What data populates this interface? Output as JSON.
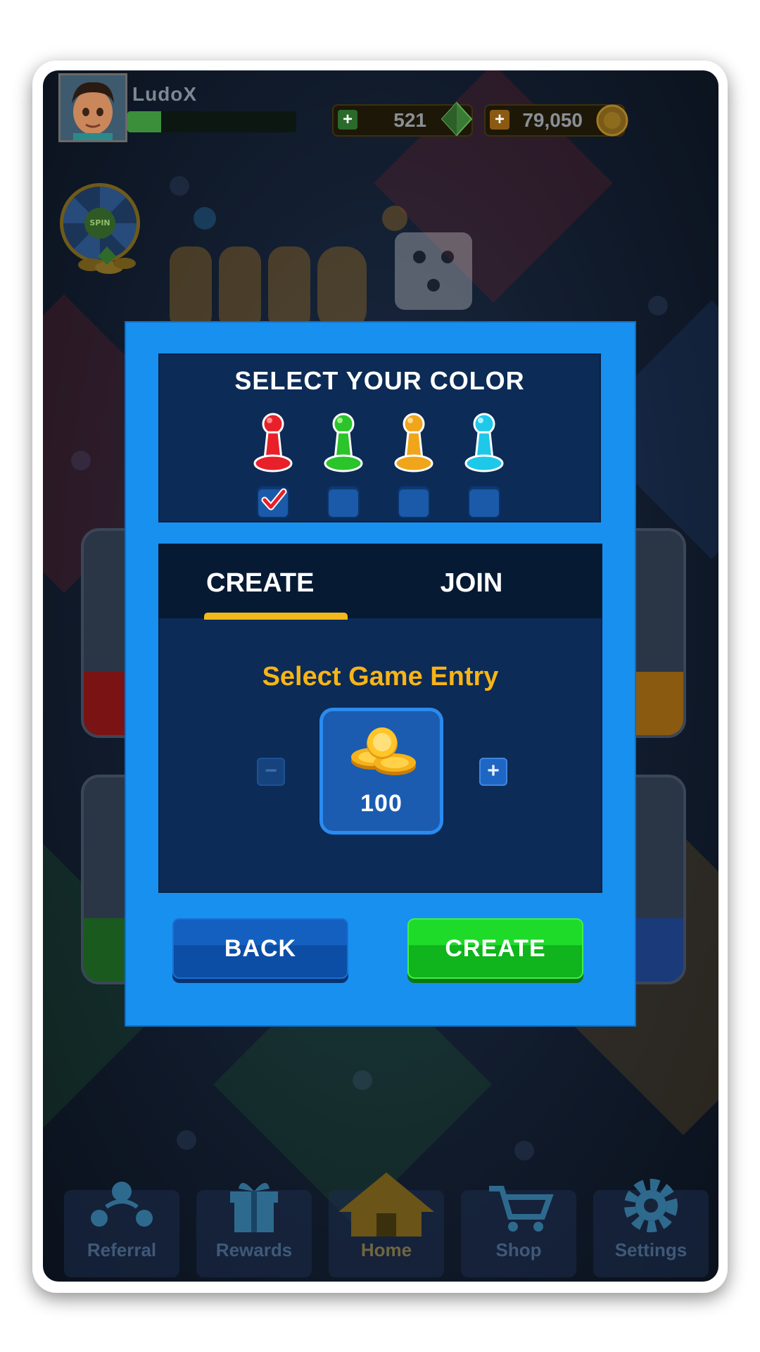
{
  "header": {
    "username": "LudoX",
    "xp_progress": 0.2,
    "gems": "521",
    "coins": "79,050"
  },
  "spin_wheel": {
    "label": "SPIN"
  },
  "color_select": {
    "title": "SELECT YOUR COLOR",
    "colors": [
      {
        "name": "red",
        "hex": "#e8202a",
        "selected": true
      },
      {
        "name": "green",
        "hex": "#2bc42a",
        "selected": false
      },
      {
        "name": "yellow",
        "hex": "#f0a51a",
        "selected": false
      },
      {
        "name": "cyan",
        "hex": "#1ec8e8",
        "selected": false
      }
    ]
  },
  "tabs": [
    {
      "label": "CREATE",
      "active": true
    },
    {
      "label": "JOIN",
      "active": false
    }
  ],
  "entry": {
    "title": "Select Game Entry",
    "amount": "100",
    "minus_label": "−",
    "plus_label": "+"
  },
  "buttons": {
    "back": "BACK",
    "create": "CREATE"
  },
  "nav": [
    {
      "label": "Referral",
      "icon": "referral-icon"
    },
    {
      "label": "Rewards",
      "icon": "gift-icon"
    },
    {
      "label": "Home",
      "icon": "home-icon"
    },
    {
      "label": "Shop",
      "icon": "cart-icon"
    },
    {
      "label": "Settings",
      "icon": "gear-icon"
    }
  ],
  "colors": {
    "modal": "#1890f0",
    "panel": "#0c2b56",
    "accent": "#f7b418",
    "create_green": "#1edb2a"
  }
}
